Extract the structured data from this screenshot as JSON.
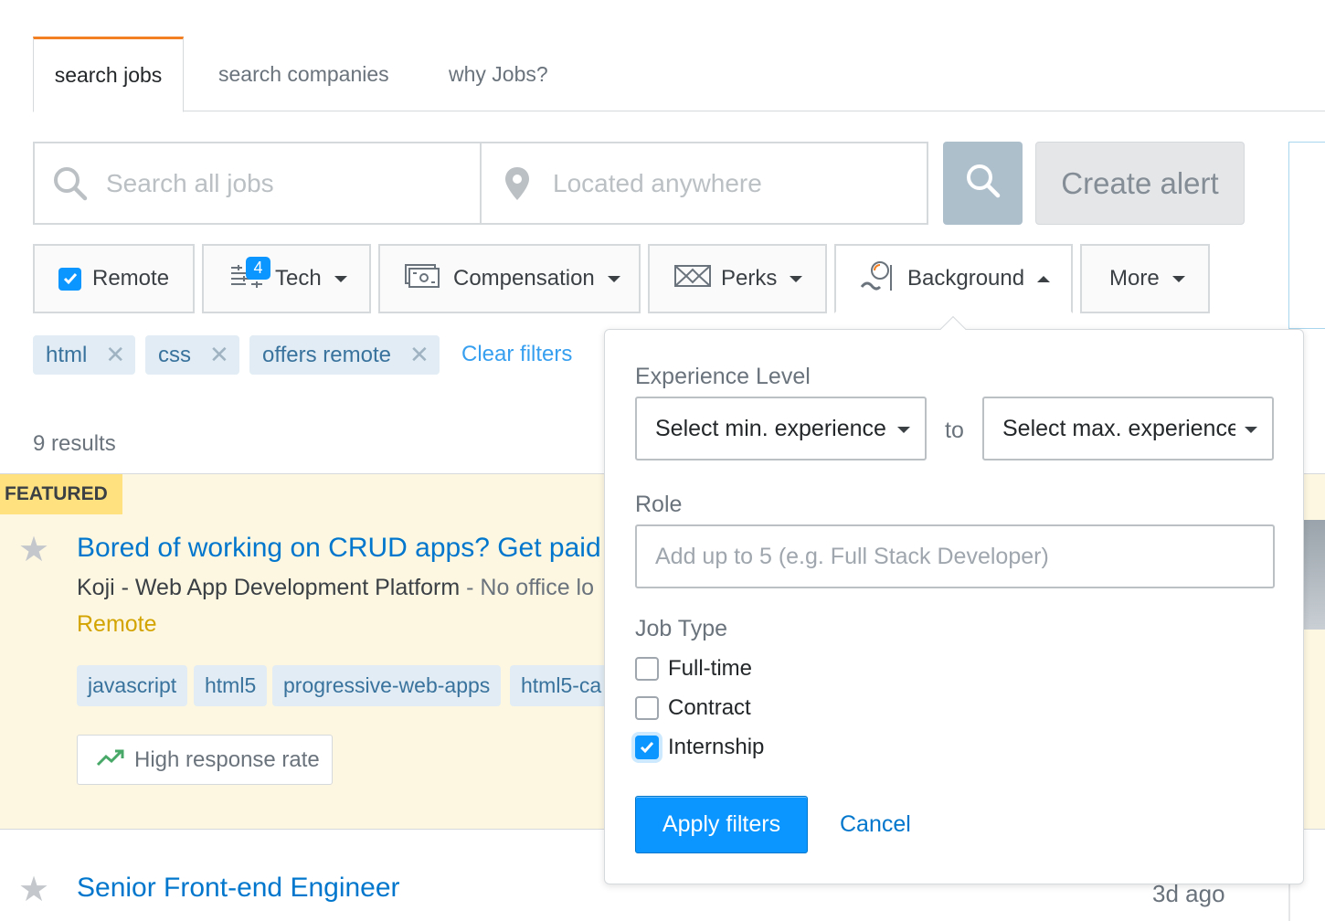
{
  "tabs": [
    {
      "label": "search jobs",
      "active": true
    },
    {
      "label": "search companies"
    },
    {
      "label": "why Jobs?"
    }
  ],
  "search": {
    "query_placeholder": "Search all jobs",
    "location_placeholder": "Located anywhere",
    "create_alert_label": "Create alert"
  },
  "filters": {
    "remote_label": "Remote",
    "tech_label": "Tech",
    "tech_count": "4",
    "compensation_label": "Compensation",
    "perks_label": "Perks",
    "background_label": "Background",
    "more_label": "More"
  },
  "chips": [
    {
      "label": "html"
    },
    {
      "label": "css"
    },
    {
      "label": "offers remote"
    }
  ],
  "clear_filters_label": "Clear filters",
  "results_count": "9 results",
  "featured_job": {
    "tag": "FEATURED",
    "title": "Bored of working on CRUD apps? Get paid",
    "company": "Koji - Web App Development Platform",
    "location": " - No office lo",
    "remote": "Remote",
    "tags": [
      "javascript",
      "html5",
      "progressive-web-apps",
      "html5-ca"
    ],
    "response_badge": "High response rate"
  },
  "second_job": {
    "title": "Senior Front-end Engineer",
    "posted": "3d ago"
  },
  "popover": {
    "experience_label": "Experience Level",
    "min_experience": "Select min. experience",
    "to_label": "to",
    "max_experience": "Select max. experience",
    "role_label": "Role",
    "role_placeholder": "Add up to 5 (e.g. Full Stack Developer)",
    "job_type_label": "Job Type",
    "job_types": [
      {
        "label": "Full-time",
        "checked": false
      },
      {
        "label": "Contract",
        "checked": false
      },
      {
        "label": "Internship",
        "checked": true
      }
    ],
    "apply_label": "Apply filters",
    "cancel_label": "Cancel"
  },
  "colors": {
    "accent": "#0a95ff",
    "tab_accent": "#f48024",
    "featured_bg": "#fdf7e2",
    "featured_tag_bg": "#ffe180",
    "remote_color": "#d3a400",
    "link": "#0077cc"
  }
}
